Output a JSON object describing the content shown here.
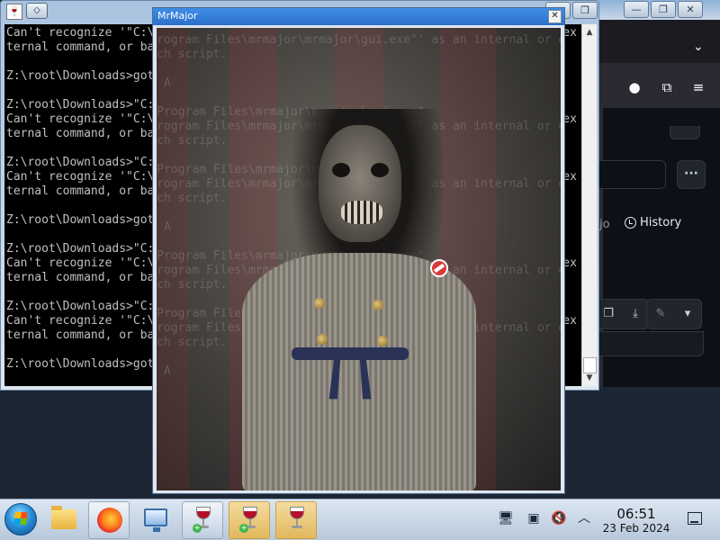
{
  "console": {
    "icon_glyph": "🍷",
    "menu_glyph": "◇",
    "minimize_glyph": "—",
    "maximize_glyph": "❐",
    "lines": [
      "Can't recognize '\"C:\\Program Files\\mrmajor\\mrmajor\\gui.exe\"' as an internal or ex",
      "ternal command, or batch script.",
      "",
      "Z:\\root\\Downloads>goto A",
      "",
      "Z:\\root\\Downloads>\"C:\\Program Files\\mrmajor\\mrmajor\\gui.exe\"",
      "Can't recognize '\"C:\\Program Files\\mrmajor\\mrmajor\\gui.exe\"' as an internal or ex",
      "ternal command, or batch script.",
      "",
      "Z:\\root\\Downloads>\"C:\\Program Files\\mrmajor\\mrmajor\\gui.exe\"",
      "Can't recognize '\"C:\\Program Files\\mrmajor\\mrmajor\\gui.exe\"' as an internal or ex",
      "ternal command, or batch script.",
      "",
      "Z:\\root\\Downloads>goto A",
      "",
      "Z:\\root\\Downloads>\"C:\\Program Files\\mrmajor\\mrmajor\\gui.exe\"",
      "Can't recognize '\"C:\\Program Files\\mrmajor\\mrmajor\\gui.exe\"' as an internal or ex",
      "ternal command, or batch script.",
      "",
      "Z:\\root\\Downloads>\"C:\\Program Files\\mrmajor\\mrmajor\\gui.exe\"",
      "Can't recognize '\"C:\\Program Files\\mrmajor\\mrmajor\\gui.exe\"' as an internal or ex",
      "ternal command, or batch script.",
      "",
      "Z:\\root\\Downloads>goto A"
    ]
  },
  "popup": {
    "title": "MrMajor",
    "close_glyph": "✕"
  },
  "browser": {
    "chevron_glyph": "⌄",
    "menu_glyph": "≡",
    "account_glyph": "●",
    "extensions_glyph": "⧉",
    "dots_label": "···",
    "tab_fragment": "jo",
    "history_label": "History",
    "copy_glyph": "❐",
    "download_glyph": "⤓",
    "edit_glyph": "✎",
    "dropdown_glyph": "▾",
    "win_minimize": "—",
    "win_restore": "❐",
    "win_close": "✕"
  },
  "taskbar": {
    "clock_time": "06:51",
    "clock_date": "23 Feb 2024",
    "tray": {
      "network_glyph": "🖥",
      "clipboard_glyph": "▣",
      "volume_glyph": "🔇",
      "chevron_glyph": "︿"
    }
  }
}
